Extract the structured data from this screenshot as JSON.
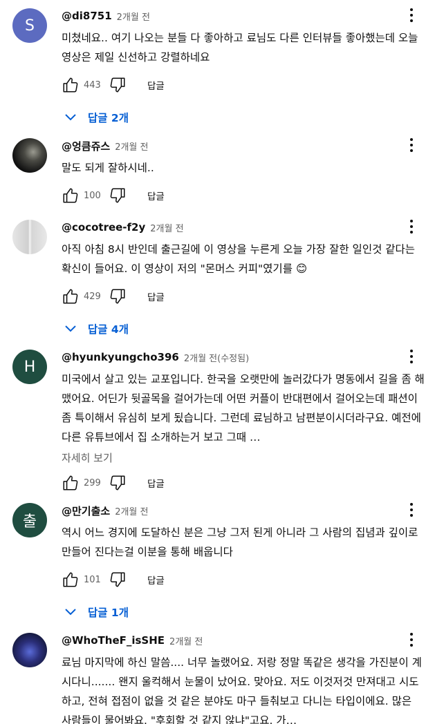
{
  "comments": [
    {
      "avatar_letter": "S",
      "author": "@di8751",
      "time": "2개월 전",
      "text": "미쳤네요.. 여기 나오는 분들 다 좋아하고 료님도 다른 인터뷰들 좋아했는데 오늘 영상은 제일 신선하고 강렬하네요",
      "likes": "443",
      "reply_label": "답글",
      "replies_label": "답글 2개"
    },
    {
      "author": "@엉큼쥬스",
      "time": "2개월 전",
      "text": "말도 되게 잘하시네..",
      "likes": "100",
      "reply_label": "답글"
    },
    {
      "author": "@cocotree-f2y",
      "time": "2개월 전",
      "text": "아직 아침 8시 반인데 출근길에 이 영상을 누른게 오늘 가장 잘한 일인것 같다는 확신이 들어요. 이 영상이 저의 \"몬머스 커피\"였기를 😊",
      "likes": "429",
      "reply_label": "답글",
      "replies_label": "답글 4개"
    },
    {
      "avatar_letter": "H",
      "author": "@hyunkyungcho396",
      "time": "2개월 전(수정됨)",
      "text": "미국에서 살고 있는 교포입니다. 한국을 오랫만에 놀러갔다가 명동에서 길을 좀 해맸어요. 어딘가 뒷골목을 걸어가는데 어떤  커플이 반대편에서 걸어오는데  패션이 좀 특이해서 유심히 보게 됬습니다. 그런데 료님하고 남편분이시더라구요. 예전에 다른 유튜브에서 집 소개하는거 보고 그때 …",
      "more_label": "자세히 보기",
      "likes": "299",
      "reply_label": "답글"
    },
    {
      "avatar_letter": "출",
      "author": "@만기출소",
      "time": "2개월 전",
      "text": "역시 어느 경지에 도달하신 분은 그냥 그저 된게 아니라 그 사람의 집념과 깊이로 만들어 진다는걸 이분을 통해 배웁니다",
      "likes": "101",
      "reply_label": "답글",
      "replies_label": "답글 1개"
    },
    {
      "author": "@WhoTheF_isSHE",
      "time": "2개월 전",
      "text": "료님 마지막에 하신 말씀.... 너무 놀랬어요. 저랑 정말 똑같은 생각을 가진분이 계시다니....... 왠지 울컥해서 눈물이 났어요. 맞아요. 저도 이것저것 만져대고 시도하고, 전혀 접점이 없을 것 같은 분야도 마구 들춰보고 다니는 타입이에요. 많은 사람들이 물어봐요. \"후회할 것 같지 않냐\"고요. 가…"
    }
  ],
  "colors": {
    "link_blue": "#065fd4",
    "secondary_text": "#606060",
    "avatar_s": "#5c6bc0",
    "avatar_h": "#1f4d40"
  }
}
